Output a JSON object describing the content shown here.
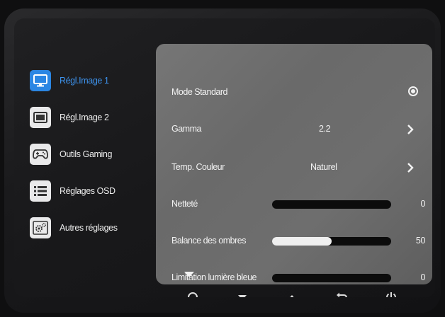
{
  "sidebar": {
    "items": [
      {
        "label": "Régl.Image 1",
        "icon": "monitor-icon",
        "active": true
      },
      {
        "label": "Régl.Image 2",
        "icon": "screen-icon",
        "active": false
      },
      {
        "label": "Outils Gaming",
        "icon": "gamepad-icon",
        "active": false
      },
      {
        "label": "Réglages OSD",
        "icon": "list-icon",
        "active": false
      },
      {
        "label": "Autres réglages",
        "icon": "settings-gear-icon",
        "active": false
      }
    ]
  },
  "panel": {
    "mode": {
      "label": "Mode Standard"
    },
    "gamma": {
      "label": "Gamma",
      "value": "2.2"
    },
    "temp": {
      "label": "Temp. Couleur",
      "value": "Naturel"
    },
    "nettete": {
      "label": "Netteté",
      "value": "0",
      "level": 0
    },
    "balance": {
      "label": "Balance des ombres",
      "value": "50",
      "level": 0.5
    },
    "lumiere": {
      "label": "Limitation lumière bleue",
      "value": "0",
      "level": 0
    }
  },
  "bottom_nav": {
    "buttons": [
      "circle-icon",
      "down-arrow-icon",
      "up-arrow-icon",
      "back-icon",
      "power-icon"
    ]
  },
  "colors": {
    "accent": "#2b86e3",
    "panel": "#6e6e6e",
    "slider_track": "#0c0c0c"
  }
}
